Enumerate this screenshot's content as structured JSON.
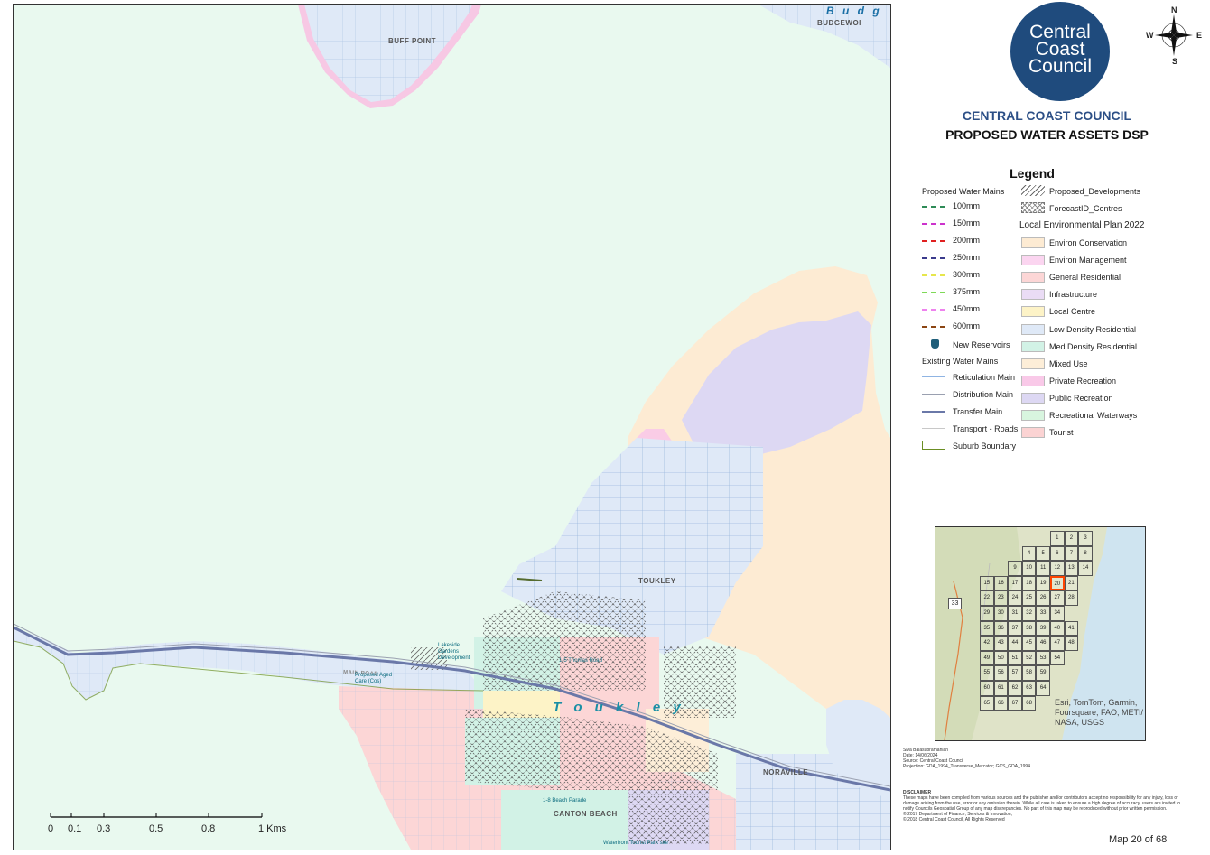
{
  "map": {
    "place_labels": {
      "buff_point": "BUFF POINT",
      "budgewoi": "BUDGEWOI",
      "budgewoi_water": "B u d g",
      "toukley_suburb": "TOUKLEY",
      "toukley_town": "T o u k l e y",
      "norahville": "NORAVILLE",
      "canton_beach": "CANTON BEACH",
      "road": "MAIN ROAD"
    },
    "site_labels": {
      "lakeside": "Lakeside Gardens Development",
      "aged_care": "Proposed Aged Care (Cos)",
      "st_thomas": "1-5 Thomas Road",
      "beach_parade": "1-8 Beach Parade",
      "tourist_park": "Waterfront Tourist Park site"
    },
    "scale_bar": {
      "ticks": [
        "0",
        "0.1",
        "0.3",
        "0.5",
        "0.8",
        "1 Kms"
      ]
    }
  },
  "header": {
    "logo_text": [
      "Central",
      "Coast",
      "Council"
    ],
    "org_title": "CENTRAL COAST COUNCIL",
    "map_title": "PROPOSED WATER ASSETS DSP",
    "compass": {
      "n": "N",
      "s": "S",
      "e": "E",
      "w": "W"
    }
  },
  "legend": {
    "title": "Legend",
    "proposed_heading": "Proposed Water Mains",
    "proposed_mains": [
      {
        "label": "100mm",
        "color": "#2e8b57"
      },
      {
        "label": "150mm",
        "color": "#cc33cc"
      },
      {
        "label": "200mm",
        "color": "#e02020"
      },
      {
        "label": "250mm",
        "color": "#3a3a8c"
      },
      {
        "label": "300mm",
        "color": "#e6e64c"
      },
      {
        "label": "375mm",
        "color": "#7ed957"
      },
      {
        "label": "450mm",
        "color": "#ee82ee"
      },
      {
        "label": "600mm",
        "color": "#8b4513"
      }
    ],
    "reservoirs": "New Reservoirs",
    "existing_heading": "Existing Water Mains",
    "existing_mains": [
      {
        "label": "Reticulation Main",
        "color": "#8fb4e3"
      },
      {
        "label": "Distribution Main",
        "color": "#9aa0b0"
      },
      {
        "label": "Transfer Main",
        "color": "#6a78a8"
      },
      {
        "label": "Transport - Roads",
        "color": "#c8c8c8"
      },
      {
        "label": "Suburb Boundary",
        "color": "#6b8e23"
      }
    ],
    "overlays": [
      {
        "label": "Proposed_Developments"
      },
      {
        "label": "ForecastID_Centres"
      }
    ],
    "lep_heading": "Local Environmental Plan 2022",
    "zones": [
      {
        "label": "Environ Conservation",
        "color": "#fdebd3"
      },
      {
        "label": "Environ Management",
        "color": "#fbd5f0"
      },
      {
        "label": "General Residential",
        "color": "#fcd6d6"
      },
      {
        "label": "Infrastructure",
        "color": "#eadcf5"
      },
      {
        "label": "Local Centre",
        "color": "#fdf3c7"
      },
      {
        "label": "Low Density Residential",
        "color": "#dfe9f7"
      },
      {
        "label": "Med Density Residential",
        "color": "#d2f2e6"
      },
      {
        "label": "Mixed Use",
        "color": "#fdeed8"
      },
      {
        "label": "Private Recreation",
        "color": "#f9c9e8"
      },
      {
        "label": "Public Recreation",
        "color": "#ddd8f3"
      },
      {
        "label": "Recreational Waterways",
        "color": "#d8f5df"
      },
      {
        "label": "Tourist",
        "color": "#fbd3d3"
      }
    ]
  },
  "inset": {
    "highlight": "20",
    "highway": "33",
    "grid": [
      [
        "",
        "",
        "",
        "",
        "",
        "1",
        "2",
        "3"
      ],
      [
        "",
        "",
        "",
        "4",
        "5",
        "6",
        "7",
        "8"
      ],
      [
        "",
        "",
        "9",
        "10",
        "11",
        "12",
        "13",
        "14"
      ],
      [
        "15",
        "16",
        "17",
        "18",
        "19",
        "20",
        "21",
        ""
      ],
      [
        "22",
        "23",
        "24",
        "25",
        "26",
        "27",
        "28",
        ""
      ],
      [
        "29",
        "30",
        "31",
        "32",
        "33",
        "34",
        "",
        ""
      ],
      [
        "35",
        "36",
        "37",
        "38",
        "39",
        "40",
        "41",
        ""
      ],
      [
        "42",
        "43",
        "44",
        "45",
        "46",
        "47",
        "48",
        ""
      ],
      [
        "49",
        "50",
        "51",
        "52",
        "53",
        "54",
        "",
        ""
      ],
      [
        "55",
        "56",
        "57",
        "58",
        "59",
        "",
        "",
        ""
      ],
      [
        "60",
        "61",
        "62",
        "63",
        "64",
        "",
        "",
        ""
      ],
      [
        "65",
        "66",
        "67",
        "68",
        "",
        "",
        "",
        ""
      ]
    ],
    "attribution": "Esri, TomTom, Garmin, Foursquare, FAO, METI/ NASA, USGS"
  },
  "metadata": {
    "author": "Siva Balasubramanian",
    "date": "Date: 14/06/2024",
    "source": "Source: Central Coast Council",
    "projection": "Projection: GDA_1994_Transverse_Mercator; GCS_GDA_1994"
  },
  "disclaimer": {
    "heading": "DISCLAIMER",
    "text": "These maps have been compiled from various sources and the publisher and/or contributors accept no responsibility for any injury, loss or damage arising from the use, error or any omission therein. While all care is taken to ensure a high degree of accuracy, users are invited to notify Councils Geospatial Group of any map discrepancies. No part of this map may be reproduced without prior written permission.",
    "copyright1": "© 2017 Department of Finance, Services & Innovation,",
    "copyright2": "© 2018 Central Coast Council, All Rights Reserved"
  },
  "map_number": "Map 20 of 68"
}
